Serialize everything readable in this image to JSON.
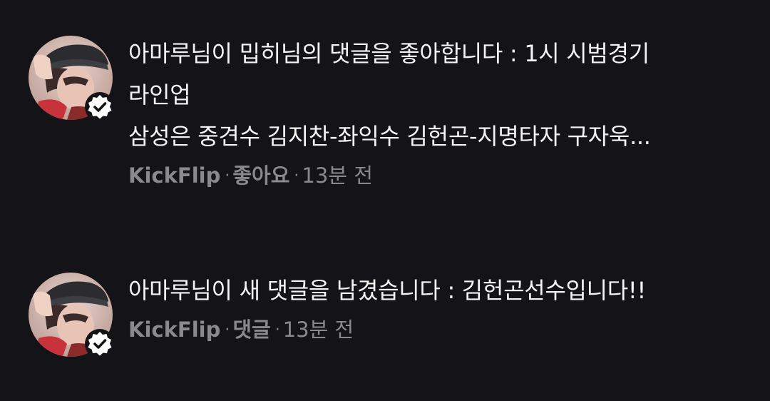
{
  "colors": {
    "background": "#141317",
    "text_primary": "#f4f4f4",
    "text_secondary": "#8a8a8e",
    "badge": "#ffffff"
  },
  "notifications": [
    {
      "avatar_icon": "user-avatar-photo",
      "badge_icon": "verified-badge-icon",
      "line1": "아마루님이 밉히님의 댓글을 좋아합니다 : 1시 시범경기",
      "line2": "라인업",
      "line3": "삼성은 중견수 김지찬-좌익수 김헌곤-지명타자 구자욱...",
      "user": "KickFlip",
      "separator": "·",
      "action": "좋아요",
      "time": "13분 전"
    },
    {
      "avatar_icon": "user-avatar-photo",
      "badge_icon": "verified-badge-icon",
      "line1": "아마루님이 새 댓글을 남겼습니다 : 김헌곤선수입니다!!",
      "user": "KickFlip",
      "separator": "·",
      "action": "댓글",
      "time": "13분 전"
    }
  ]
}
